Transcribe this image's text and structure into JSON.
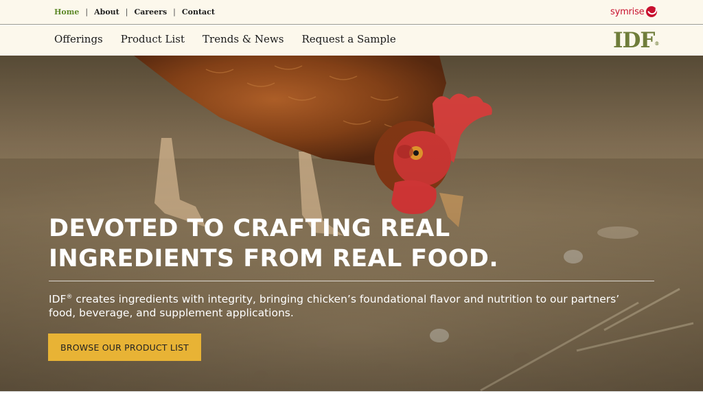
{
  "utility_nav": {
    "items": [
      {
        "label": "Home",
        "active": true
      },
      {
        "label": "About"
      },
      {
        "label": "Careers"
      },
      {
        "label": "Contact"
      }
    ],
    "separator": "|"
  },
  "symrise_logo": {
    "text": "symrise",
    "color": "#c8102e",
    "icon": "symrise-mark-icon"
  },
  "main_nav": {
    "items": [
      {
        "label": "Offerings"
      },
      {
        "label": "Product List"
      },
      {
        "label": "Trends & News"
      },
      {
        "label": "Request a Sample"
      }
    ]
  },
  "brand_logo": {
    "text": "IDF",
    "mark": "®",
    "color": "#6f7d3a"
  },
  "hero": {
    "headline_line1": "DEVOTED TO CRAFTING REAL",
    "headline_line2": "INGREDIENTS FROM REAL FOOD.",
    "subtext_brand": "IDF",
    "subtext_mark": "®",
    "subtext_rest": " creates ingredients with integrity, bringing chicken’s foundational flavor and nutrition to our partners’ food, beverage, and supplement applications.",
    "cta_label": "BROWSE OUR PRODUCT LIST",
    "image_subject": "hen pecking on dirt ground"
  },
  "colors": {
    "accent_green": "#5f8a2b",
    "cta_yellow": "#e8b335",
    "bar_bg": "#fcf8ec"
  }
}
